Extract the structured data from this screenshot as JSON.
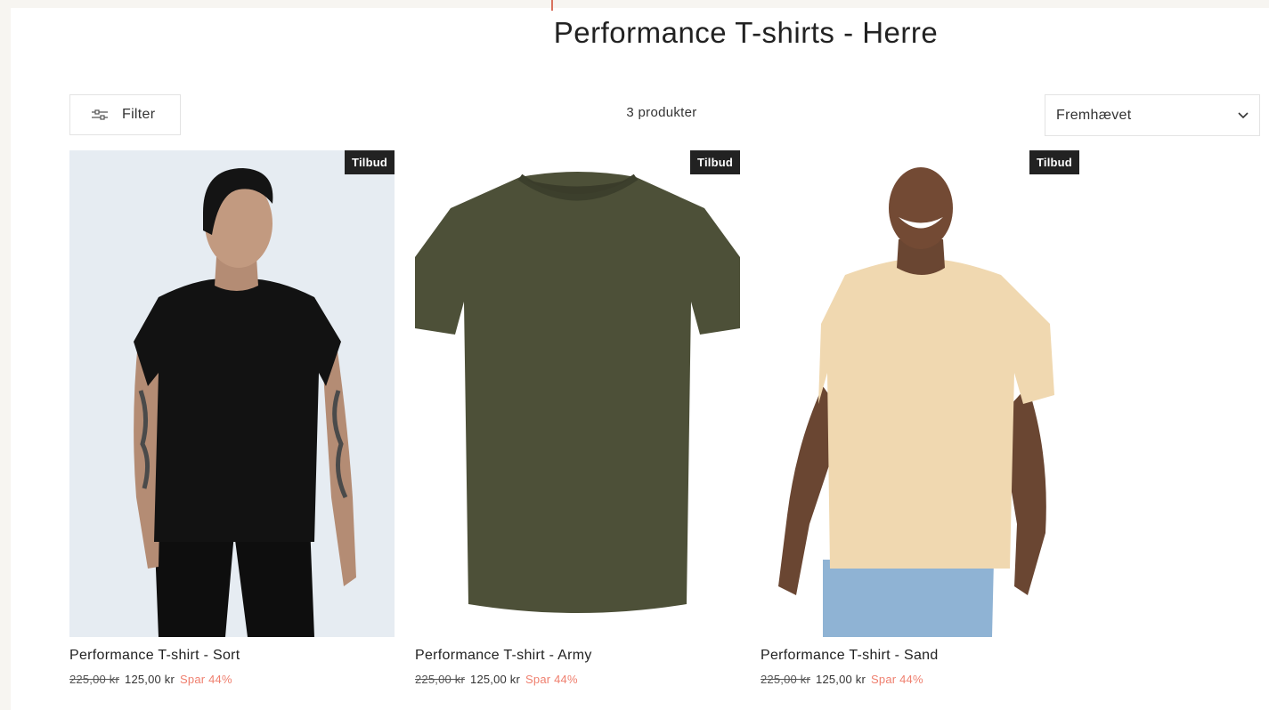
{
  "page": {
    "title": "Performance T-shirts - Herre"
  },
  "toolbar": {
    "filter_label": "Filter",
    "count_text": "3 produkter",
    "sort_value": "Fremhævet"
  },
  "products": [
    {
      "badge": "Tilbud",
      "name": "Performance T-shirt - Sort",
      "old_price": "225,00 kr",
      "price": "125,00 kr",
      "save": "Spar 44%"
    },
    {
      "badge": "Tilbud",
      "name": "Performance T-shirt - Army",
      "old_price": "225,00 kr",
      "price": "125,00 kr",
      "save": "Spar 44%"
    },
    {
      "badge": "Tilbud",
      "name": "Performance T-shirt - Sand",
      "old_price": "225,00 kr",
      "price": "125,00 kr",
      "save": "Spar 44%"
    }
  ],
  "colors": {
    "accent": "#d9735f",
    "save": "#ef7f6e",
    "badge_bg": "#222222",
    "shirt_black": "#121212",
    "shirt_army": "#4d5038",
    "shirt_sand": "#f0d8b0"
  }
}
